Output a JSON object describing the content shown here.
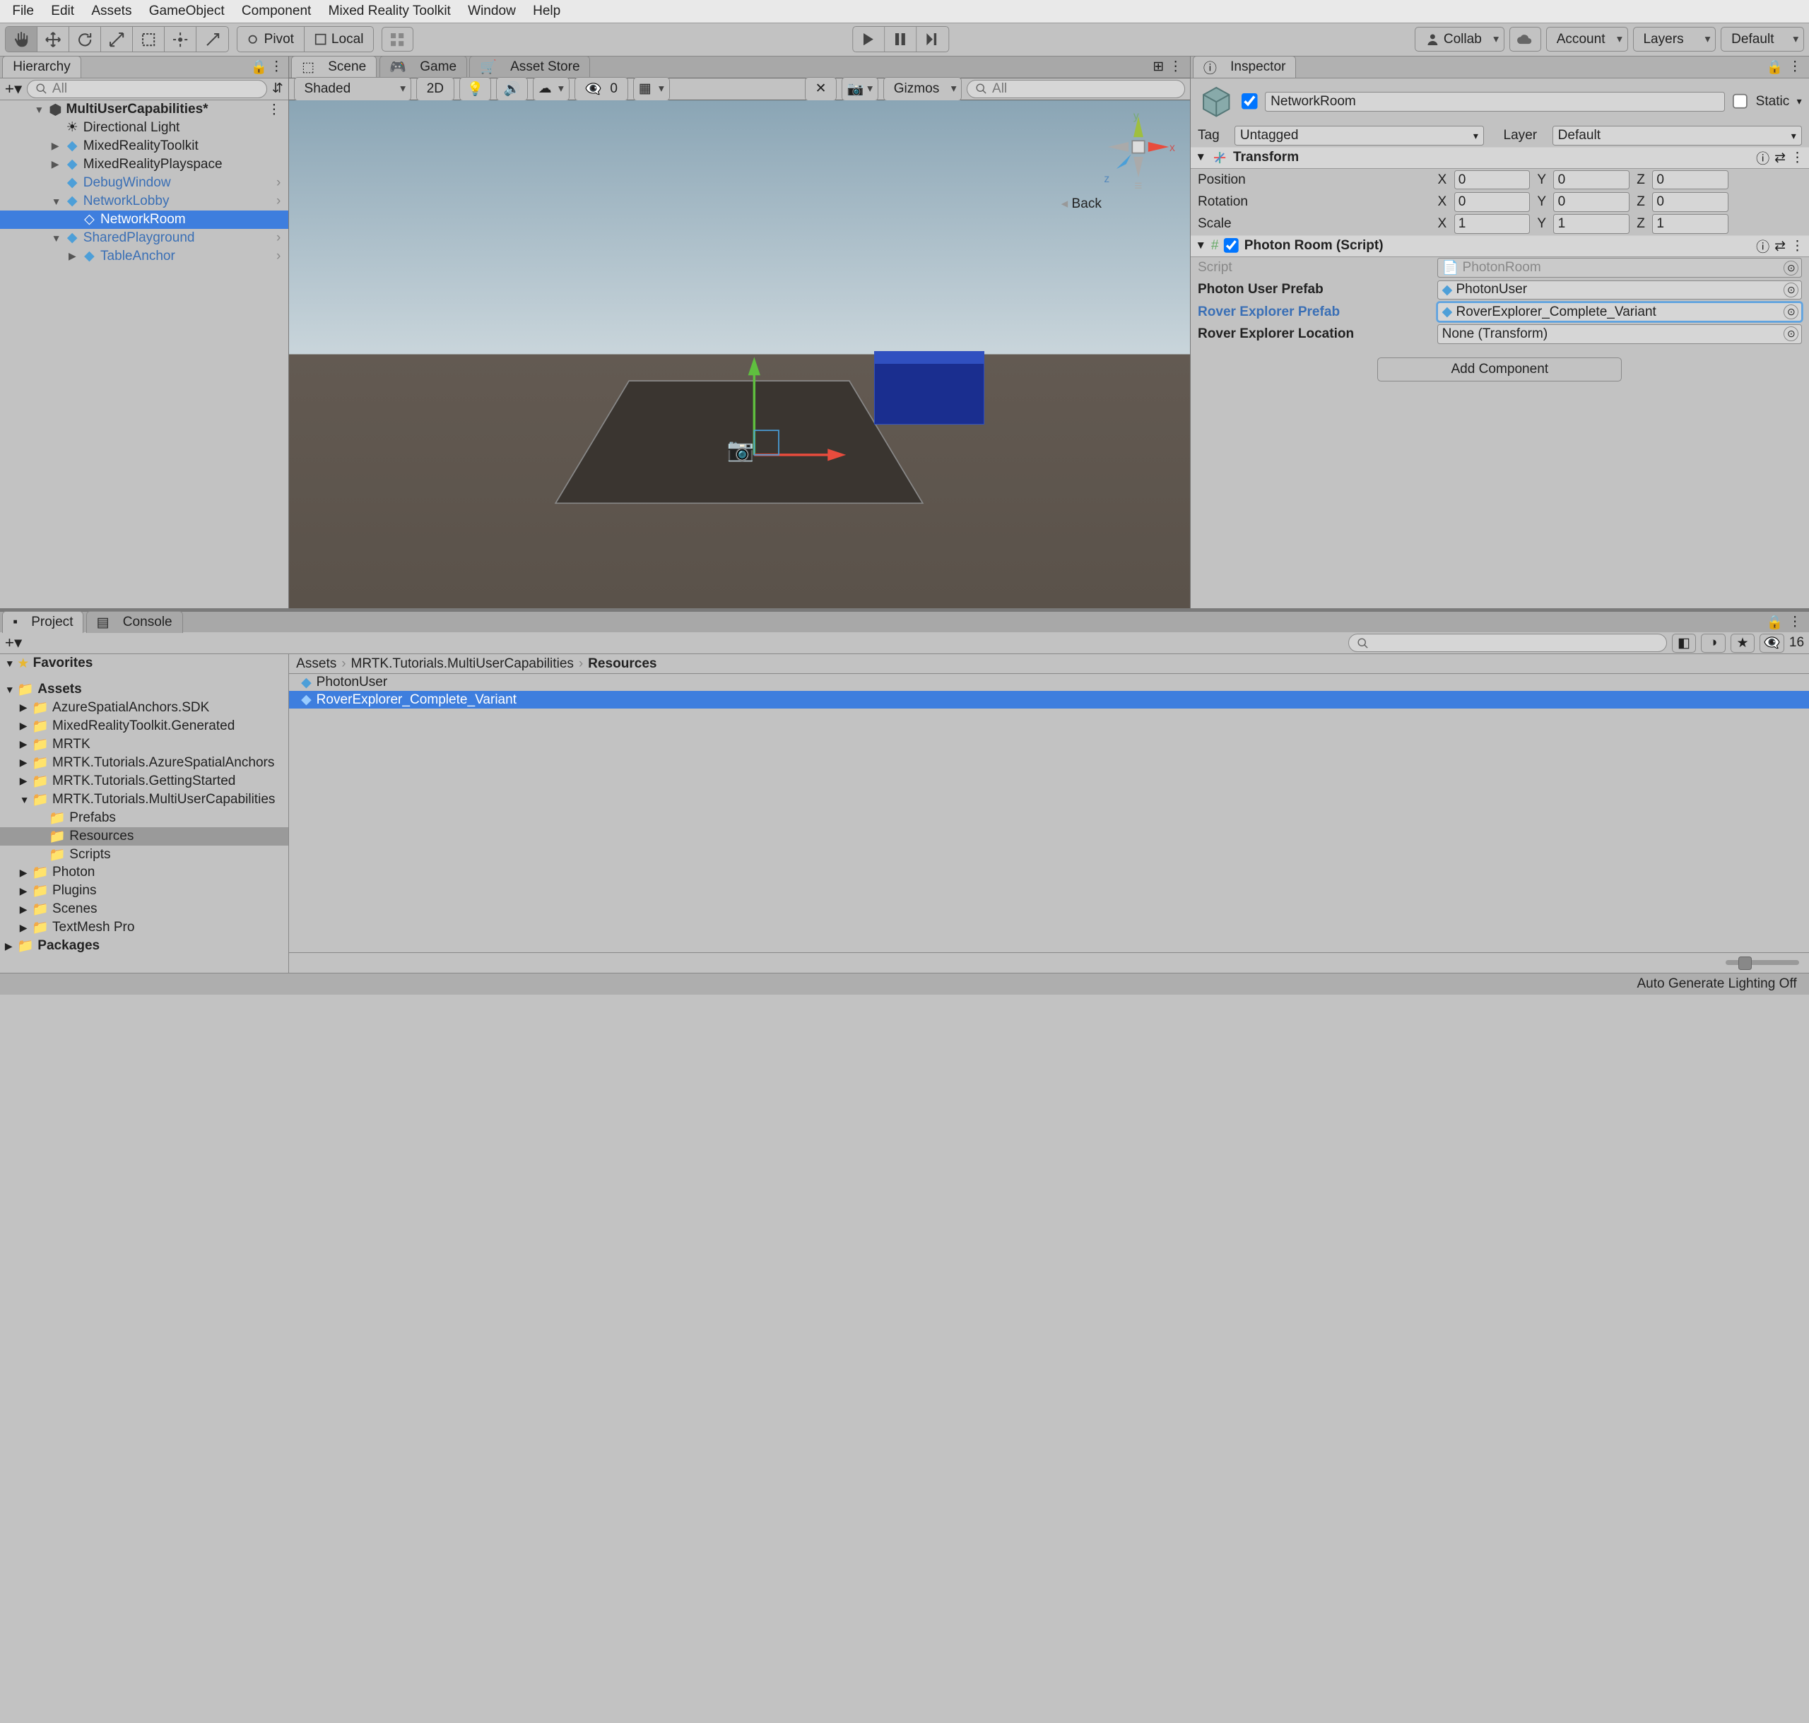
{
  "menu": [
    "File",
    "Edit",
    "Assets",
    "GameObject",
    "Component",
    "Mixed Reality Toolkit",
    "Window",
    "Help"
  ],
  "toolbar": {
    "pivot": "Pivot",
    "local": "Local",
    "collab": "Collab",
    "account": "Account",
    "layers": "Layers",
    "layout": "Default"
  },
  "hierarchy": {
    "title": "Hierarchy",
    "searchPlaceholder": "All",
    "scene": "MultiUserCapabilities*",
    "items": [
      {
        "name": "Directional Light",
        "depth": 1,
        "type": "light"
      },
      {
        "name": "MixedRealityToolkit",
        "depth": 1,
        "type": "prefab",
        "expand": false
      },
      {
        "name": "MixedRealityPlayspace",
        "depth": 1,
        "type": "prefab",
        "expand": false
      },
      {
        "name": "DebugWindow",
        "depth": 1,
        "type": "prefab-link",
        "arrow": true
      },
      {
        "name": "NetworkLobby",
        "depth": 1,
        "type": "prefab-link",
        "expand": true,
        "arrow": true
      },
      {
        "name": "NetworkRoom",
        "depth": 2,
        "type": "go",
        "selected": true
      },
      {
        "name": "SharedPlayground",
        "depth": 1,
        "type": "prefab-link",
        "expand": true,
        "arrow": true
      },
      {
        "name": "TableAnchor",
        "depth": 2,
        "type": "prefab-link",
        "expand": false,
        "arrow": true
      }
    ]
  },
  "centerTabs": {
    "scene": "Scene",
    "game": "Game",
    "asset": "Asset Store"
  },
  "sceneToolbar": {
    "shaded": "Shaded",
    "twoD": "2D",
    "zero": "0",
    "gizmos": "Gizmos",
    "all": "All"
  },
  "sceneOverlay": {
    "back": "Back",
    "x": "x",
    "y": "y",
    "z": "z"
  },
  "inspector": {
    "title": "Inspector",
    "name": "NetworkRoom",
    "static": "Static",
    "tagLabel": "Tag",
    "tag": "Untagged",
    "layerLabel": "Layer",
    "layer": "Default",
    "transform": {
      "title": "Transform",
      "position": {
        "label": "Position",
        "x": "0",
        "y": "0",
        "z": "0"
      },
      "rotation": {
        "label": "Rotation",
        "x": "0",
        "y": "0",
        "z": "0"
      },
      "scale": {
        "label": "Scale",
        "x": "1",
        "y": "1",
        "z": "1"
      }
    },
    "photonRoom": {
      "title": "Photon Room (Script)",
      "scriptLabel": "Script",
      "script": "PhotonRoom",
      "userPrefabLabel": "Photon User Prefab",
      "userPrefab": "PhotonUser",
      "roverPrefabLabel": "Rover Explorer Prefab",
      "roverPrefab": "RoverExplorer_Complete_Variant",
      "roverLocLabel": "Rover Explorer Location",
      "roverLoc": "None (Transform)"
    },
    "addComponent": "Add Component"
  },
  "project": {
    "tab": "Project",
    "console": "Console",
    "breadcrumb": [
      "Assets",
      "MRTK.Tutorials.MultiUserCapabilities",
      "Resources"
    ],
    "favorites": "Favorites",
    "assetsRoot": "Assets",
    "folders": [
      "AzureSpatialAnchors.SDK",
      "MixedRealityToolkit.Generated",
      "MRTK",
      "MRTK.Tutorials.AzureSpatialAnchors",
      "MRTK.Tutorials.GettingStarted",
      "MRTK.Tutorials.MultiUserCapabilities"
    ],
    "subfolders": [
      "Prefabs",
      "Resources",
      "Scripts"
    ],
    "folders2": [
      "Photon",
      "Plugins",
      "Scenes",
      "TextMesh Pro"
    ],
    "packages": "Packages",
    "assets": [
      {
        "name": "PhotonUser"
      },
      {
        "name": "RoverExplorer_Complete_Variant",
        "selected": true
      }
    ],
    "count": "16"
  },
  "status": "Auto Generate Lighting Off"
}
